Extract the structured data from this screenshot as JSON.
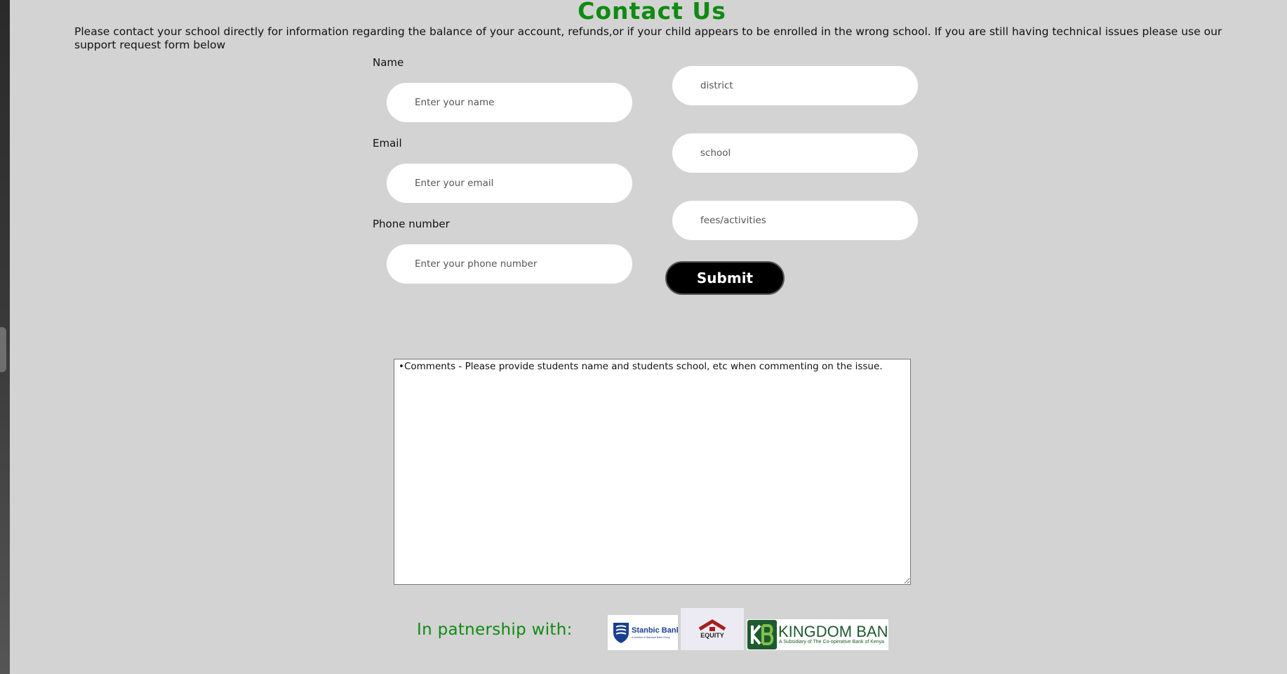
{
  "page": {
    "title": "Contact Us",
    "intro": "Please contact your school directly for information regarding the balance of your account, refunds,or if your child appears to be enrolled in the wrong school. If you are still having technical issues please use our support request form below"
  },
  "form": {
    "name_label": "Name",
    "name_placeholder": "Enter your name",
    "email_label": "Email",
    "email_placeholder": "Enter your email",
    "phone_label": "Phone number",
    "phone_placeholder": "Enter your phone number",
    "district_placeholder": "district",
    "school_placeholder": "school",
    "fees_placeholder": "fees/activities",
    "submit_label": "Submit",
    "comments_placeholder": "•Comments - Please provide students name and students school, etc when commenting on the issue."
  },
  "partners": {
    "label": "In patnership with:",
    "stanbic": {
      "name": "Stanbic Bank",
      "tagline": "A member of Standard Bank Group"
    },
    "equity": {
      "name": "EQUITY"
    },
    "kingdom": {
      "name": "KINGDOM BANK",
      "tagline": "A Subsidiary of The Co-operative Bank of Kenya"
    }
  },
  "colors": {
    "accent_green": "#0f8a12",
    "background": "#d3d3d3",
    "submit_bg": "#000000",
    "stanbic_blue": "#1a3f8f",
    "equity_red": "#a3201c",
    "kingdom_green": "#1e5a2e"
  },
  "icons": {
    "stanbic_logo": "stanbic-shield-logo",
    "equity_logo": "equity-house-logo",
    "kingdom_logo": "kingdom-kb-logo"
  }
}
